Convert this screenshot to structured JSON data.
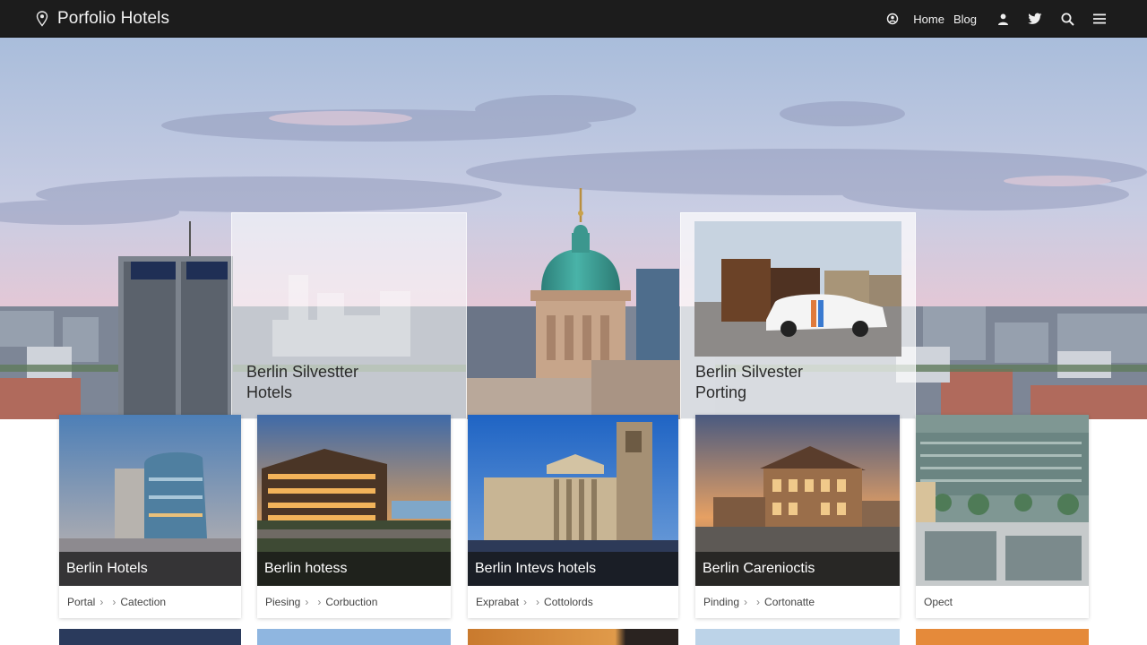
{
  "header": {
    "brand": "Porfolio Hotels",
    "nav": {
      "home": "Home",
      "blog": "Blog"
    },
    "icons": [
      "location-pin-icon",
      "user-circle-icon",
      "user-icon",
      "twitter-icon",
      "search-icon",
      "menu-icon"
    ]
  },
  "hero": {
    "cards": [
      {
        "title": "Berlin Silvestter Hotels"
      },
      {
        "title": "Berlin Silvester Porting"
      }
    ]
  },
  "tiles": [
    {
      "title": "Berlin Hotels",
      "crumb1": "Portal",
      "crumb2": "Catection"
    },
    {
      "title": "Berlin hotess",
      "crumb1": "Piesing",
      "crumb2": "Corbuction"
    },
    {
      "title": "Berlin Intevs hotels",
      "crumb1": "Exprabat",
      "crumb2": "Cottolords"
    },
    {
      "title": "Berlin Carenioctis",
      "crumb1": "Pinding",
      "crumb2": "Cortonatte"
    },
    {
      "title": "",
      "crumb1": "Opect",
      "crumb2": ""
    }
  ],
  "colors": {
    "topbar": "#1c1c1c",
    "sky_top": "#a9bddb",
    "sky_bottom": "#e9c9d3",
    "dome": "#3fa39a"
  }
}
